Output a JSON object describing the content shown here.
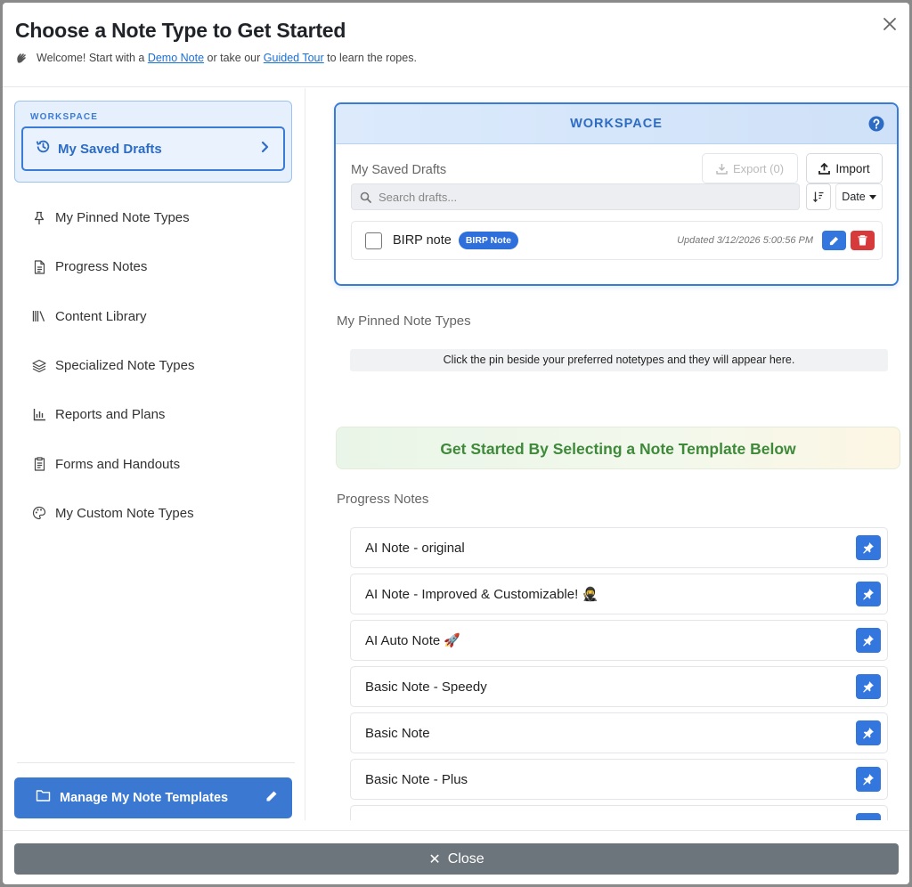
{
  "header": {
    "title": "Choose a Note Type to Get Started",
    "subtitle_pre": "Welcome! Start with a",
    "demo_link": "Demo Note",
    "subtitle_mid": "or take our",
    "tour_link": "Guided Tour",
    "subtitle_post": "to learn the ropes."
  },
  "sidebar": {
    "workspace_label": "WORKSPACE",
    "active_item": "My Saved Drafts",
    "items": [
      {
        "label": "My Pinned Note Types",
        "icon": "pin-icon"
      },
      {
        "label": "Progress Notes",
        "icon": "document-icon"
      },
      {
        "label": "Content Library",
        "icon": "library-icon"
      },
      {
        "label": "Specialized Note Types",
        "icon": "layers-icon"
      },
      {
        "label": "Reports and Plans",
        "icon": "bar-chart-icon"
      },
      {
        "label": "Forms and Handouts",
        "icon": "clipboard-icon"
      },
      {
        "label": "My Custom Note Types",
        "icon": "palette-icon"
      }
    ],
    "manage_button": "Manage My Note Templates"
  },
  "workspace": {
    "title": "WORKSPACE",
    "drafts_title": "My Saved Drafts",
    "export_label": "Export (0)",
    "import_label": "Import",
    "search_placeholder": "Search drafts...",
    "sort_label": "Date",
    "drafts": [
      {
        "name": "BIRP note",
        "badge": "BIRP Note",
        "updated": "Updated 3/12/2026 5:00:56 PM"
      }
    ]
  },
  "pinned": {
    "title": "My Pinned Note Types",
    "empty_text": "Click the pin beside your preferred notetypes and they will appear here."
  },
  "get_started": "Get Started By Selecting a Note Template Below",
  "progress_notes": {
    "title": "Progress Notes",
    "items": [
      "AI Note - original",
      "AI Note - Improved & Customizable! 🥷",
      "AI Auto Note 🚀",
      "Basic Note - Speedy",
      "Basic Note",
      "Basic Note - Plus",
      ""
    ]
  },
  "footer": {
    "close_label": "Close"
  },
  "colors": {
    "accent": "#3a7bd5",
    "danger": "#d63a3a",
    "success_text": "#3e8a3a",
    "footer_button": "#6c747c"
  }
}
